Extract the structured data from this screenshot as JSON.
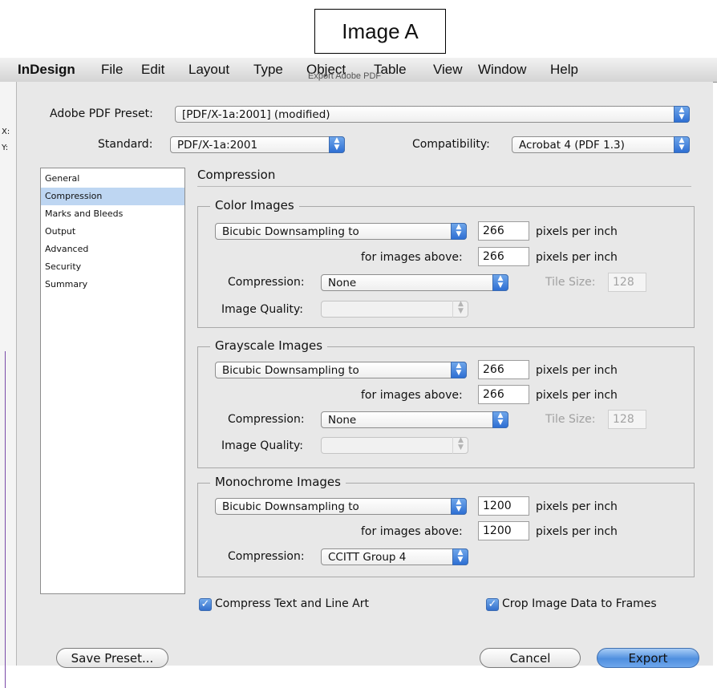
{
  "image_label": "Image A",
  "menubar": {
    "app": "InDesign",
    "items": [
      "File",
      "Edit",
      "Layout",
      "Type",
      "Object",
      "Table",
      "View",
      "Window",
      "Help"
    ]
  },
  "window_title": "Export Adobe PDF",
  "left_strip": {
    "x_label": "X:",
    "y_label": "Y:"
  },
  "preset": {
    "label": "Adobe PDF Preset:",
    "value": "[PDF/X-1a:2001] (modified)"
  },
  "standard": {
    "label": "Standard:",
    "value": "PDF/X-1a:2001"
  },
  "compatibility": {
    "label": "Compatibility:",
    "value": "Acrobat 4 (PDF 1.3)"
  },
  "sidebar": {
    "items": [
      "General",
      "Compression",
      "Marks and Bleeds",
      "Output",
      "Advanced",
      "Security",
      "Summary"
    ],
    "selected": "Compression"
  },
  "section_title": "Compression",
  "color_images": {
    "title": "Color Images",
    "sampling": "Bicubic Downsampling to",
    "ppi": "266",
    "ppi_unit": "pixels per inch",
    "above_label": "for images above:",
    "above": "266",
    "above_unit": "pixels per inch",
    "compression_label": "Compression:",
    "compression": "None",
    "tile_label": "Tile Size:",
    "tile": "128",
    "quality_label": "Image Quality:",
    "quality": ""
  },
  "grayscale_images": {
    "title": "Grayscale Images",
    "sampling": "Bicubic Downsampling to",
    "ppi": "266",
    "ppi_unit": "pixels per inch",
    "above_label": "for images above:",
    "above": "266",
    "above_unit": "pixels per inch",
    "compression_label": "Compression:",
    "compression": "None",
    "tile_label": "Tile Size:",
    "tile": "128",
    "quality_label": "Image Quality:",
    "quality": ""
  },
  "monochrome_images": {
    "title": "Monochrome Images",
    "sampling": "Bicubic Downsampling to",
    "ppi": "1200",
    "ppi_unit": "pixels per inch",
    "above_label": "for images above:",
    "above": "1200",
    "above_unit": "pixels per inch",
    "compression_label": "Compression:",
    "compression": "CCITT Group 4"
  },
  "options": {
    "compress_text": {
      "label": "Compress Text and Line Art",
      "checked": true
    },
    "crop_image": {
      "label": "Crop Image Data to Frames",
      "checked": true
    }
  },
  "buttons": {
    "save_preset": "Save Preset...",
    "cancel": "Cancel",
    "export": "Export"
  },
  "colors": {
    "accent": "#3470cc",
    "selection": "#bed6f2",
    "dialog_bg": "#e8e8e8"
  }
}
